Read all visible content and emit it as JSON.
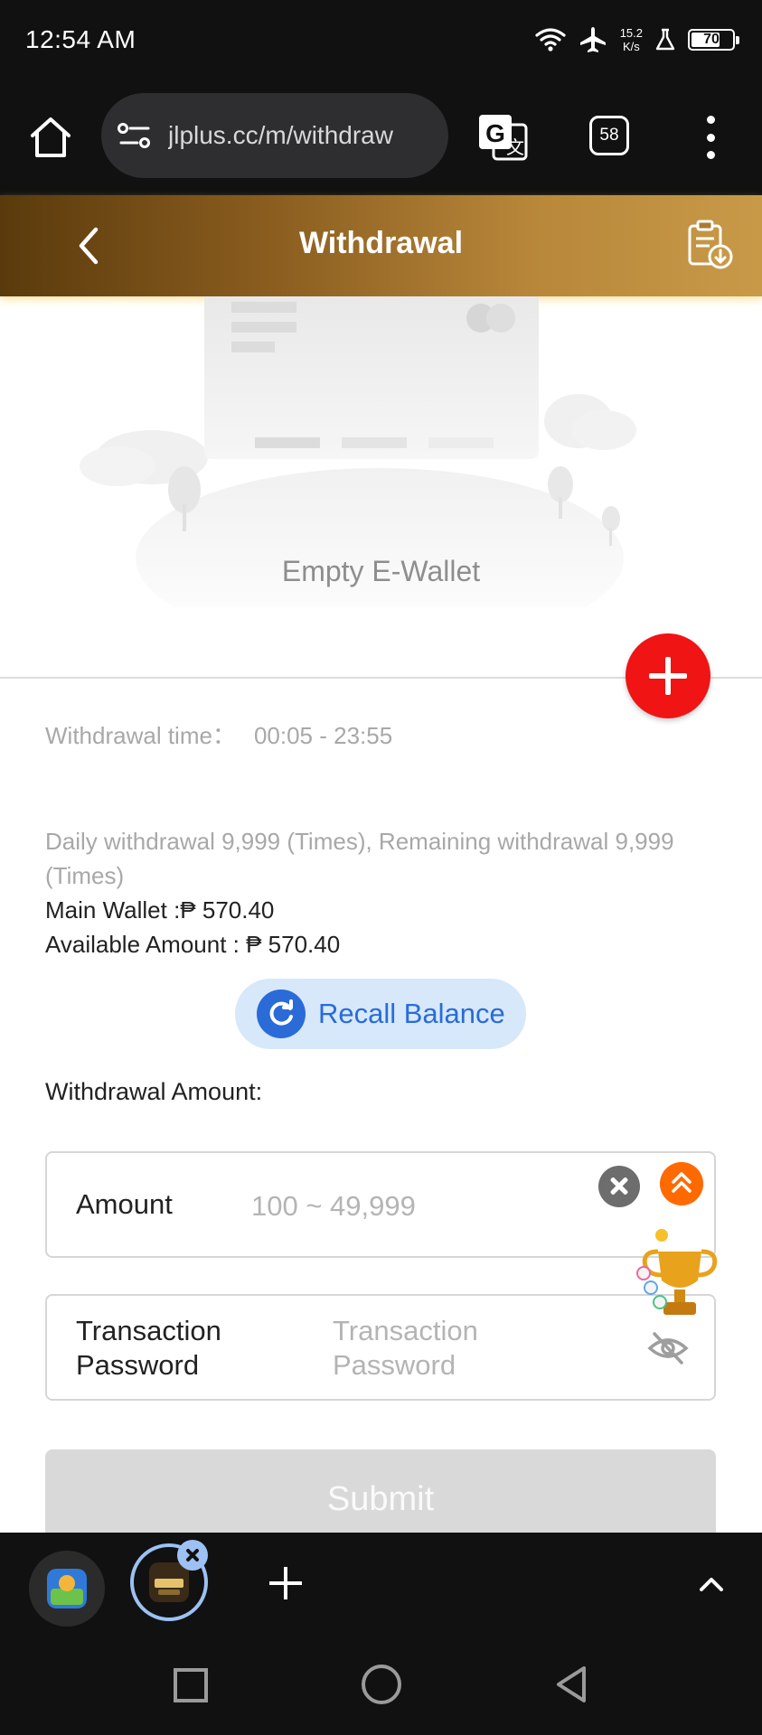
{
  "status_bar": {
    "time": "12:54 AM",
    "speed_value": "15.2",
    "speed_unit": "K/s",
    "battery": "70",
    "battery_level": 0.7
  },
  "browser": {
    "url": "jlplus.cc/m/withdraw",
    "tab_count": "58"
  },
  "header": {
    "title": "Withdrawal",
    "accent_gradient": [
      "#5a3a0c",
      "#c89a48"
    ]
  },
  "wallet": {
    "empty_text": "Empty E-Wallet"
  },
  "info": {
    "withdrawal_time_label": "Withdrawal time：",
    "withdrawal_time_value": "00:05 - 23:55",
    "daily_limit": "Daily withdrawal 9,999 (Times), Remaining withdrawal 9,999 (Times)",
    "main_wallet": "Main Wallet :₱ 570.40",
    "available_amount": "Available Amount : ₱ 570.40"
  },
  "recall_button": {
    "label": "Recall Balance",
    "color": "#2a6bd8"
  },
  "form": {
    "amount_heading": "Withdrawal Amount:",
    "amount_label": "Amount",
    "amount_placeholder": "100 ~ 49,999",
    "password_label_line1": "Transaction",
    "password_label_line2": "Password",
    "password_placeholder_line1": "Transaction",
    "password_placeholder_line2": "Password",
    "submit_label": "Submit"
  },
  "icons": {
    "home": "home-icon",
    "site_settings": "site-settings-icon",
    "translate": "translate-icon",
    "menu": "more-vert-icon",
    "back": "chevron-left-icon",
    "record": "clipboard-download-icon",
    "add": "plus-icon",
    "refresh": "refresh-icon",
    "clear": "clear-icon",
    "scroll_top": "double-chevron-up-icon",
    "eye_off": "eye-off-icon",
    "trophy": "trophy-icon"
  },
  "colors": {
    "add_button": "#f01414",
    "scroll_top": "#ff6a00"
  }
}
